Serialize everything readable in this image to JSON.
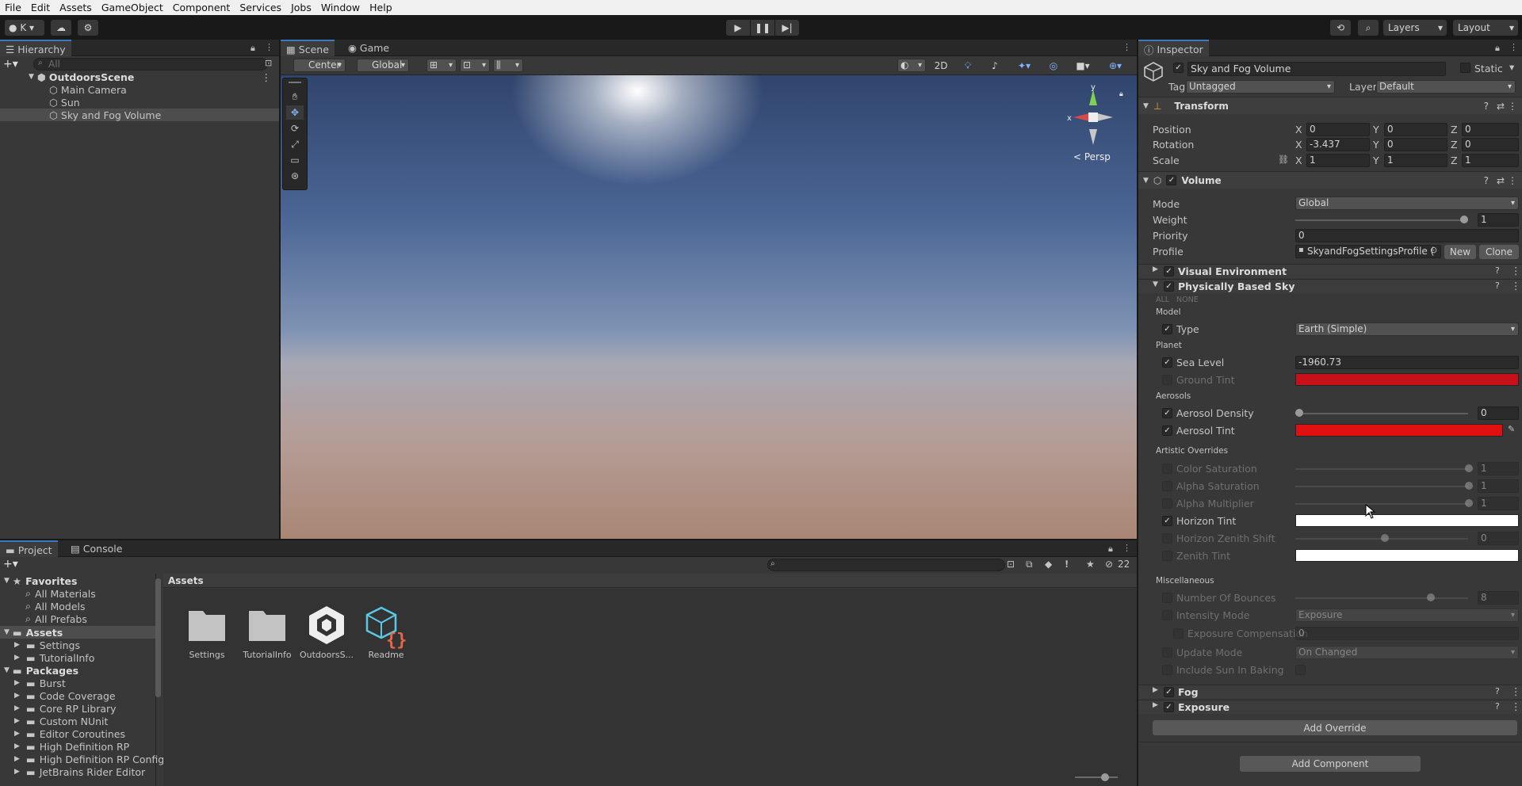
{
  "menubar": {
    "items": [
      "File",
      "Edit",
      "Assets",
      "GameObject",
      "Component",
      "Services",
      "Jobs",
      "Window",
      "Help"
    ]
  },
  "toolbar": {
    "account": "K",
    "layers": "Layers",
    "layout": "Layout"
  },
  "hierarchy": {
    "title": "Hierarchy",
    "search_placeholder": "All",
    "scene": "OutdoorsScene",
    "items": [
      "Main Camera",
      "Sun",
      "Sky and Fog Volume"
    ]
  },
  "scene": {
    "tabs": [
      "Scene",
      "Game"
    ],
    "pivot": "Center",
    "space": "Global",
    "btn2d": "2D",
    "persp": "< Persp",
    "gizmo_y": "y",
    "gizmo_x": "x"
  },
  "project": {
    "tabs": [
      "Project",
      "Console"
    ],
    "favorites_label": "Favorites",
    "favorites": [
      "All Materials",
      "All Models",
      "All Prefabs"
    ],
    "assets_label": "Assets",
    "assets_children": [
      "Settings",
      "TutorialInfo"
    ],
    "packages_label": "Packages",
    "packages": [
      "Burst",
      "Code Coverage",
      "Core RP Library",
      "Custom NUnit",
      "Editor Coroutines",
      "High Definition RP",
      "High Definition RP Config",
      "JetBrains Rider Editor"
    ],
    "breadcrumb": "Assets",
    "hidden_count": "22",
    "grid": [
      "Settings",
      "TutorialInfo",
      "OutdoorsS...",
      "Readme"
    ]
  },
  "inspector": {
    "title": "Inspector",
    "object_name": "Sky and Fog Volume",
    "static_label": "Static",
    "tag_label": "Tag",
    "tag": "Untagged",
    "layer_label": "Layer",
    "layer": "Default",
    "transform": {
      "title": "Transform",
      "position_label": "Position",
      "rotation_label": "Rotation",
      "scale_label": "Scale",
      "position": [
        "0",
        "0",
        "0"
      ],
      "rotation": [
        "-3.437",
        "0",
        "0"
      ],
      "scale": [
        "1",
        "1",
        "1"
      ],
      "axes": [
        "X",
        "Y",
        "Z"
      ]
    },
    "volume": {
      "title": "Volume",
      "mode_label": "Mode",
      "mode": "Global",
      "weight_label": "Weight",
      "weight": "1",
      "weight_fraction": 1.0,
      "priority_label": "Priority",
      "priority": "0",
      "profile_label": "Profile",
      "profile": "SkyandFogSettingsProfile (",
      "new_btn": "New",
      "clone_btn": "Clone"
    },
    "overrides": {
      "visual_env": "Visual Environment",
      "pbs": "Physically Based Sky",
      "all": "ALL",
      "none": "NONE",
      "model_header": "Model",
      "type_label": "Type",
      "type": "Earth (Simple)",
      "planet_header": "Planet",
      "sea_level_label": "Sea Level",
      "sea_level": "-1960.73",
      "ground_tint_label": "Ground Tint",
      "aerosols_header": "Aerosols",
      "aerosol_density_label": "Aerosol Density",
      "aerosol_density": "0",
      "aerosol_tint_label": "Aerosol Tint",
      "artistic_header": "Artistic Overrides",
      "color_saturation_label": "Color Saturation",
      "color_saturation": "1",
      "alpha_saturation_label": "Alpha Saturation",
      "alpha_saturation": "1",
      "alpha_multiplier_label": "Alpha Multiplier",
      "alpha_multiplier": "1",
      "horizon_tint_label": "Horizon Tint",
      "horizon_zenith_shift_label": "Horizon Zenith Shift",
      "horizon_zenith_shift": "0",
      "zenith_tint_label": "Zenith Tint",
      "misc_header": "Miscellaneous",
      "bounces_label": "Number Of Bounces",
      "bounces": "8",
      "intensity_mode_label": "Intensity Mode",
      "intensity_mode": "Exposure",
      "exposure_comp_label": "Exposure Compensation",
      "exposure_comp": "0",
      "update_mode_label": "Update Mode",
      "update_mode": "On Changed",
      "include_sun_label": "Include Sun In Baking",
      "fog": "Fog",
      "exposure": "Exposure",
      "add_override": "Add Override"
    },
    "add_component": "Add Component"
  },
  "colors": {
    "ground_tint": "#c8101a",
    "aerosol_tint": "#e01010",
    "horizon_tint": "#ffffff",
    "zenith_tint": "#ffffff",
    "accent": "#3a79bb"
  }
}
